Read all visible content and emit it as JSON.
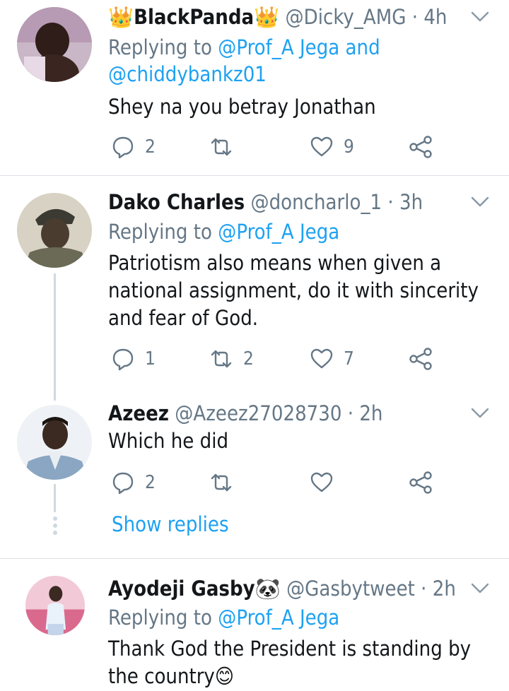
{
  "tweets": [
    {
      "name_prefix_emoji": "👑",
      "name": "BlackPanda",
      "name_suffix_emoji": "👑",
      "handle": "@Dicky_AMG",
      "time": "4h",
      "reply_to_prefix": "Replying to ",
      "reply_to_mention_1": "@Prof_A Jega",
      "reply_to_and": " and",
      "reply_to_mention_2": "@chiddybankz01",
      "text": "Shey na you betray  Jonathan",
      "replies": "2",
      "retweets": "",
      "likes": "9"
    },
    {
      "name": "Dako  Charles",
      "handle": "@doncharlo_1",
      "time": "3h",
      "reply_to_prefix": "Replying to ",
      "reply_to_mention_1": "@Prof_A Jega",
      "text_line1": "Patriotism also means when given a",
      "text_line2": "national assignment,  do it with sincerity",
      "text_line3": "and fear of God.",
      "replies": "1",
      "retweets": "2",
      "likes": "7"
    },
    {
      "name": "Azeez",
      "handle": "@Azeez27028730",
      "time": "2h",
      "text": "Which he did",
      "replies": "2",
      "retweets": "",
      "likes": ""
    },
    {
      "name": "Ayodeji Gasby",
      "name_suffix_emoji": "🐼",
      "handle": "@Gasbytweet",
      "time": "2h",
      "reply_to_prefix": "Replying to ",
      "reply_to_mention_1": "@Prof_A Jega",
      "text_line1": "Thank God the President is standing by",
      "text_line2": "the country",
      "text_emoji": "😊"
    }
  ],
  "show_replies_label": "Show replies",
  "separator": " · ",
  "icons": [
    "reply-icon",
    "retweet-icon",
    "like-icon",
    "share-icon",
    "chevron-down-icon"
  ],
  "colors": {
    "accent": "#1da1f2",
    "muted": "#657786",
    "text": "#14171a",
    "divider": "#dbe1e6"
  }
}
